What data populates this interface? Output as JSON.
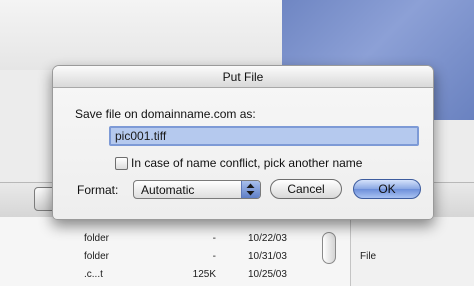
{
  "dialog": {
    "title": "Put File",
    "prompt": "Save file on domainname.com as:",
    "filename_value": "pic001.tiff",
    "conflict_option_label": "In case of name conflict, pick another name",
    "conflict_option_checked": false,
    "format_label": "Format:",
    "format_selected": "Automatic",
    "cancel_label": "Cancel",
    "ok_label": "OK"
  },
  "file_list": {
    "rows": [
      {
        "name": "folder",
        "size": "-",
        "date": "10/22/03"
      },
      {
        "name": "folder",
        "size": "-",
        "date": "10/31/03"
      },
      {
        "name": ".c...t",
        "size": "125K",
        "date": "10/25/03"
      }
    ]
  },
  "side_panel": {
    "label": "File"
  },
  "colors": {
    "accent": "#7d9ad6",
    "selection": "#b5c9ee",
    "default_button": "#8aa7e3",
    "background_panel": "#7b90c9"
  }
}
